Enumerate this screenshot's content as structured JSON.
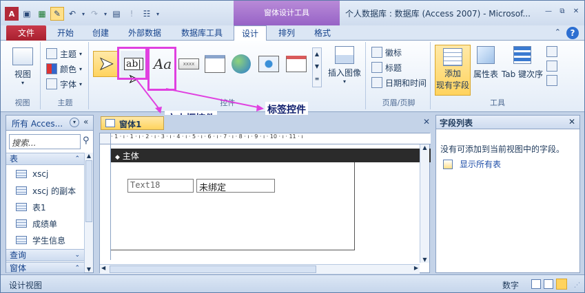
{
  "titlebar": {
    "contextual_group": "窗体设计工具",
    "window_title": "个人数据库 : 数据库 (Access 2007) - Microsof...",
    "controls": [
      "—",
      "⧉",
      "✕"
    ]
  },
  "tabs": [
    {
      "label": "文件"
    },
    {
      "label": "开始"
    },
    {
      "label": "创建"
    },
    {
      "label": "外部数据"
    },
    {
      "label": "数据库工具"
    },
    {
      "label": "设计"
    },
    {
      "label": "排列"
    },
    {
      "label": "格式"
    }
  ],
  "ribbon": {
    "views": {
      "button": "视图",
      "group": "视图"
    },
    "themes": {
      "items": [
        "主题",
        "颜色",
        "字体"
      ],
      "group": "主题"
    },
    "controls": {
      "group": "控件",
      "textbox_glyph": "ab|",
      "label_glyph": "Aa",
      "insert_image": "插入图像"
    },
    "header_footer": {
      "items": [
        "徽标",
        "标题",
        "日期和时间"
      ],
      "group": "页眉/页脚"
    },
    "tools": {
      "add_fields_line1": "添加",
      "add_fields_line2": "现有字段",
      "property_sheet": "属性表",
      "tab_order": "Tab 键次序",
      "group": "工具"
    }
  },
  "annotations": {
    "textbox": "文本框控件",
    "label": "标签控件"
  },
  "nav": {
    "header": "所有 Acces...",
    "search_placeholder": "搜索...",
    "cat_tables": "表",
    "tables": [
      "xscj",
      "xscj 的副本",
      "表1",
      "成绩单",
      "学生信息"
    ],
    "cat_queries": "查询",
    "cat_forms": "窗体"
  },
  "document": {
    "tab": "窗体1",
    "ruler_marks": "· 1 · ı · 1 · ı · 2 · ı · 3 · ı · 4 · ı · 5 · ı · 6 · ı · 7 · ı · 8 · ı · 9 · ı · 10 · ı · 11 · ı",
    "section": "主体",
    "textbox_value": "Text18",
    "label_value": "未绑定"
  },
  "fieldlist": {
    "title": "字段列表",
    "message": "没有可添加到当前视图中的字段。",
    "show_all": "显示所有表"
  },
  "status": {
    "left": "设计视图",
    "right": "数字"
  },
  "colors": {
    "accent_magenta": "#e040e0",
    "file_tab": "#b22a39"
  }
}
